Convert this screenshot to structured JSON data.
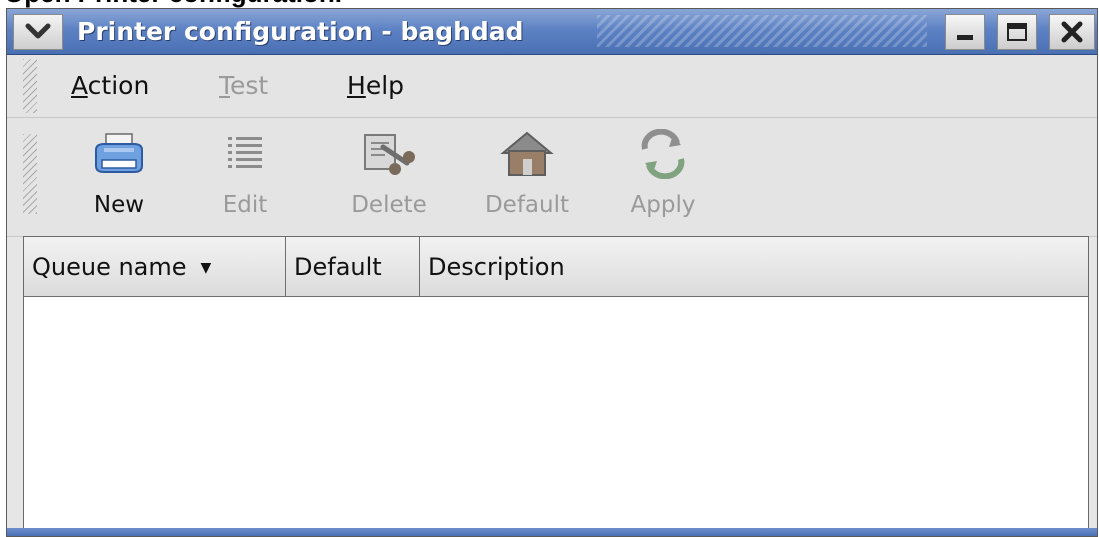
{
  "caption": "Open Printer configuration.",
  "window": {
    "title": "Printer configuration - baghdad",
    "controls": {
      "menu_icon": "chevron-down-icon",
      "minimize_icon": "minimize-icon",
      "maximize_icon": "maximize-icon",
      "close_icon": "close-icon"
    }
  },
  "menubar": [
    {
      "pre": "",
      "mnemonic": "A",
      "rest": "ction",
      "enabled": true
    },
    {
      "pre": "",
      "mnemonic": "T",
      "rest": "est",
      "enabled": false
    },
    {
      "pre": "",
      "mnemonic": "H",
      "rest": "elp",
      "enabled": true
    }
  ],
  "toolbar": [
    {
      "label": "New",
      "icon": "printer-icon",
      "enabled": true
    },
    {
      "label": "Edit",
      "icon": "list-icon",
      "enabled": false
    },
    {
      "label": "Delete",
      "icon": "delete-icon",
      "enabled": false
    },
    {
      "label": "Default",
      "icon": "home-icon",
      "enabled": false
    },
    {
      "label": "Apply",
      "icon": "apply-icon",
      "enabled": false
    }
  ],
  "table": {
    "columns": [
      {
        "label": "Queue name",
        "sorted": true
      },
      {
        "label": "Default",
        "sorted": false
      },
      {
        "label": "Description",
        "sorted": false
      }
    ],
    "rows": []
  },
  "colors": {
    "titlebar": "#5d82c4",
    "disabled_text": "#9a9a9a"
  }
}
